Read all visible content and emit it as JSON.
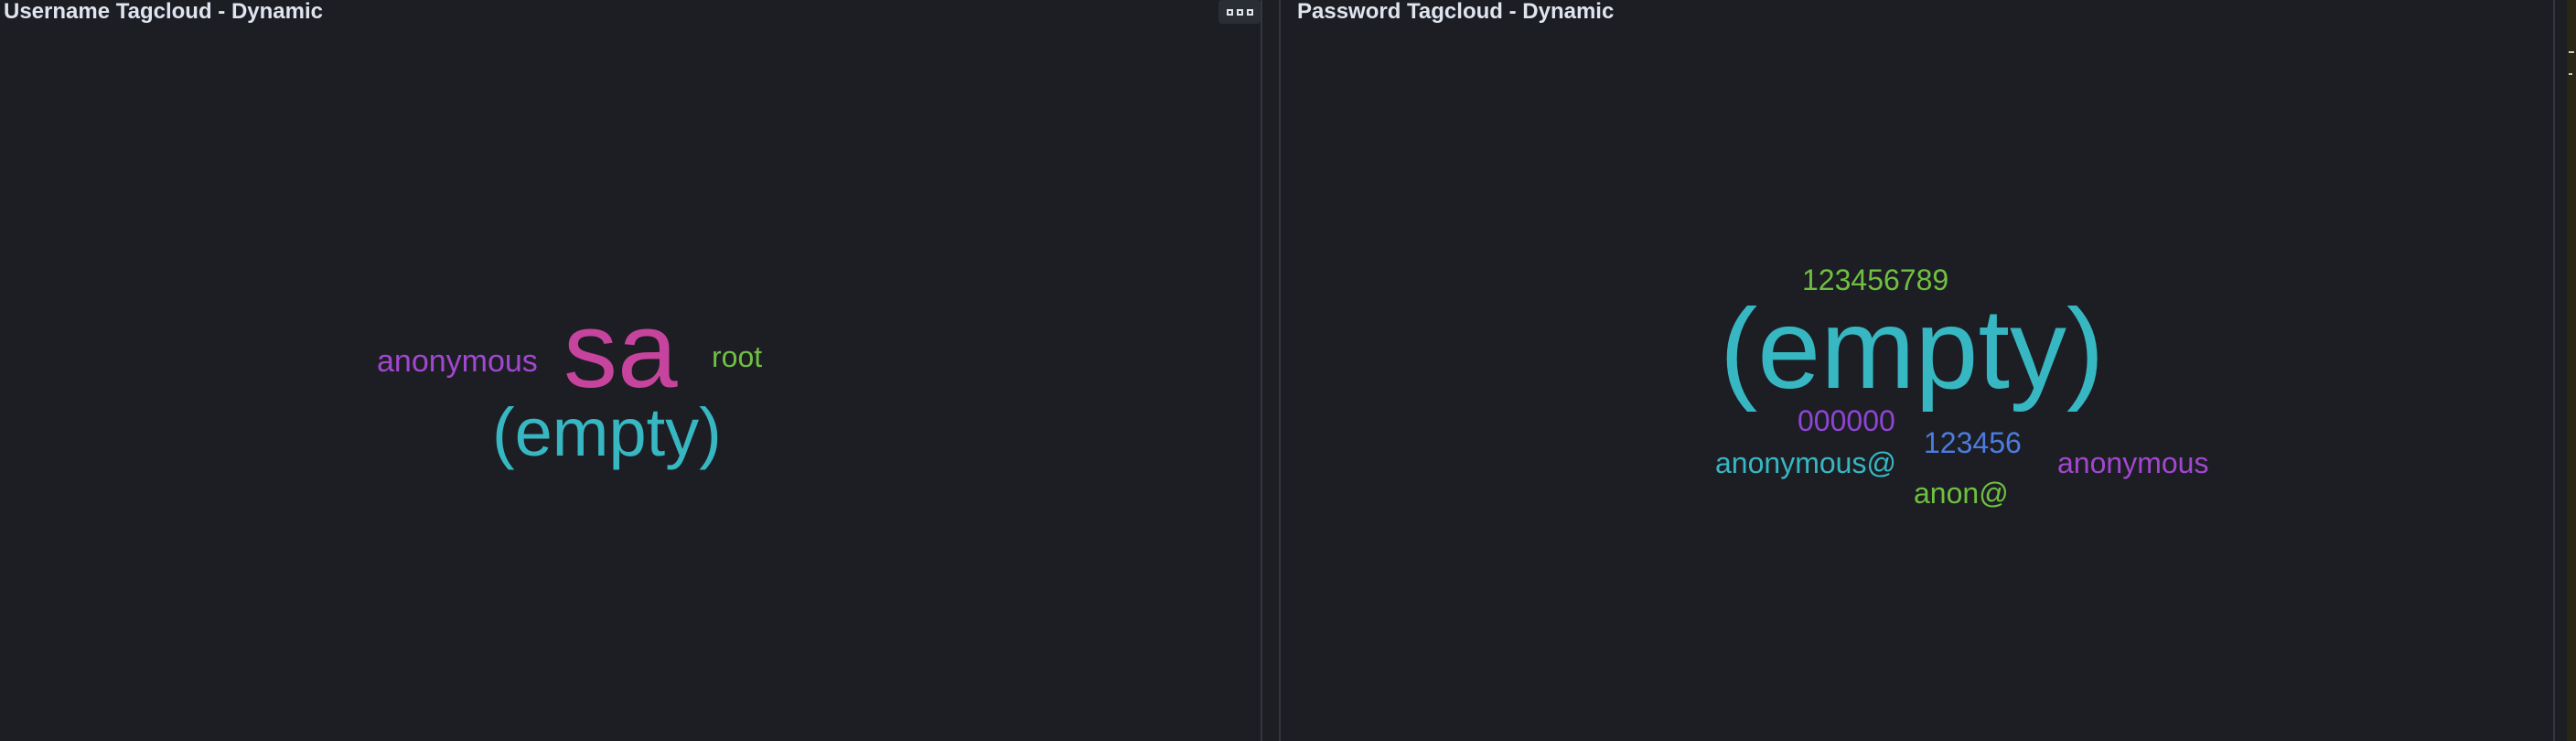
{
  "username_panel": {
    "title": "Username Tagcloud - Dynamic",
    "options_icon": "options-dots-icon",
    "tags": [
      {
        "text": "sa",
        "color": "#c6449d"
      },
      {
        "text": "(empty)",
        "color": "#36b7c2"
      },
      {
        "text": "anonymous",
        "color": "#a247d0"
      },
      {
        "text": "root",
        "color": "#6fc041"
      }
    ]
  },
  "password_panel": {
    "title": "Password Tagcloud - Dynamic",
    "tags": [
      {
        "text": "(empty)",
        "color": "#36b7c2"
      },
      {
        "text": "123456789",
        "color": "#6fc041"
      },
      {
        "text": "000000",
        "color": "#8f45d4"
      },
      {
        "text": "123456",
        "color": "#4c7ce0"
      },
      {
        "text": "anonymous@",
        "color": "#36b7c2"
      },
      {
        "text": "anonymous",
        "color": "#a247d0"
      },
      {
        "text": "anon@",
        "color": "#6fc041"
      }
    ]
  },
  "colors": {
    "background": "#1d1e24",
    "title": "#dfe5ef",
    "border": "#34363e"
  }
}
